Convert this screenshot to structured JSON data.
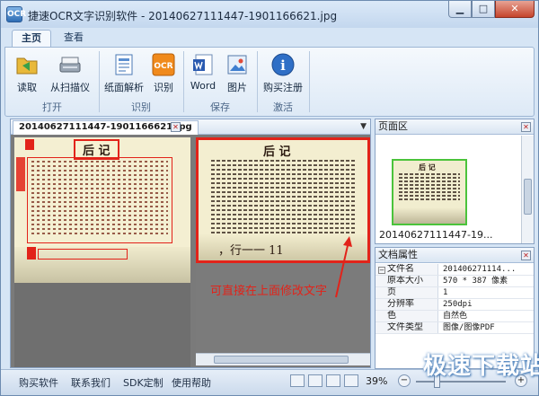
{
  "window": {
    "title": "捷速OCR文字识别软件 - 20140627111447-1901166621.jpg",
    "app_icon_text": "OCR"
  },
  "ribbon_tabs": [
    {
      "label": "主页",
      "active": true
    },
    {
      "label": "查看",
      "active": false
    }
  ],
  "ribbon": {
    "groups": [
      {
        "label": "打开",
        "buttons": [
          {
            "label": "读取",
            "icon": "folder-open-icon"
          },
          {
            "label": "从扫描仪",
            "icon": "scanner-icon"
          }
        ]
      },
      {
        "label": "识别",
        "buttons": [
          {
            "label": "纸面解析",
            "icon": "page-layout-icon"
          },
          {
            "label": "识别",
            "icon": "ocr-icon",
            "icon_text": "OCR"
          }
        ]
      },
      {
        "label": "保存",
        "buttons": [
          {
            "label": "Word",
            "icon": "word-icon"
          },
          {
            "label": "图片",
            "icon": "image-icon"
          }
        ]
      },
      {
        "label": "激活",
        "buttons": [
          {
            "label": "购买注册",
            "icon": "info-icon",
            "icon_text": "i"
          }
        ]
      }
    ]
  },
  "document": {
    "tab_label": "20140627111447-1901166621.jpg",
    "left_heading": "后 记",
    "right_heading": "后 记",
    "right_footer_text": "，行一一 11",
    "annotation": "可直接在上面修改文字"
  },
  "thumbnail_panel": {
    "title": "页面区",
    "caption": "20140627111447-19...",
    "thumb_heading": "后 记"
  },
  "props_panel": {
    "title": "文档属性",
    "rows": [
      {
        "key": "文件名",
        "value": "201406271114..."
      },
      {
        "key": "原本大小",
        "value": "570 * 387 像素"
      },
      {
        "key": "页",
        "value": "1"
      },
      {
        "key": "分辨率",
        "value": "250dpi"
      },
      {
        "key": "色",
        "value": "自然色"
      },
      {
        "key": "文件类型",
        "value": "图像/图像PDF"
      }
    ]
  },
  "statusbar": {
    "links": [
      "购买软件",
      "联系我们",
      "SDK定制",
      "使用帮助"
    ],
    "zoom": "39%",
    "zoom_out": "−",
    "zoom_in": "+"
  },
  "watermark": "极速下载站",
  "colors": {
    "highlight_red": "#e2231a",
    "thumb_green": "#4bc33b",
    "ribbon_bg": "#dde9f6"
  }
}
